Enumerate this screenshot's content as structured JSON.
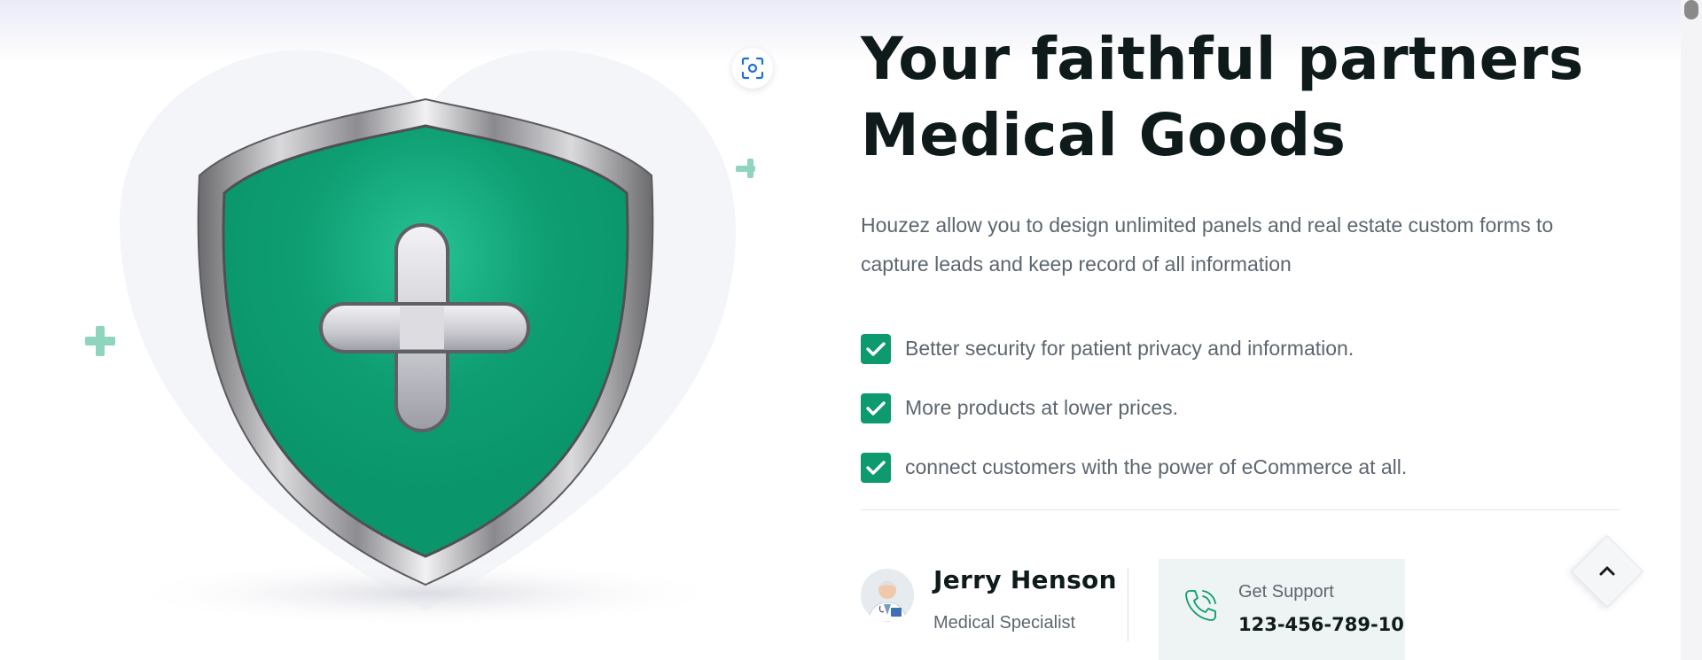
{
  "colors": {
    "accent": "#0d9a6e",
    "heading": "#0f1b1b",
    "body_text": "#5d6670",
    "support_bg": "#eef3f3"
  },
  "illustration": {
    "name": "medical-shield-with-cross",
    "decorations": [
      "plus-icon",
      "plus-icon"
    ],
    "scan_icon": "scan-icon"
  },
  "hero": {
    "title_line1": "Your faithful partners",
    "title_line2": "Medical Goods",
    "description": "Houzez allow you to design unlimited panels and real estate custom forms to capture leads and keep record of all information",
    "features": [
      {
        "icon": "check-icon",
        "text": "Better security for patient privacy and information."
      },
      {
        "icon": "check-icon",
        "text": "More products at lower prices."
      },
      {
        "icon": "check-icon",
        "text": "connect customers with the power of eCommerce at all."
      }
    ]
  },
  "author": {
    "name": "Jerry Henson",
    "role": "Medical Specialist",
    "avatar": "doctor-avatar"
  },
  "support": {
    "icon": "phone-icon",
    "label": "Get Support",
    "phone": "123-456-789-10"
  },
  "back_to_top": {
    "icon": "chevron-up-icon"
  }
}
